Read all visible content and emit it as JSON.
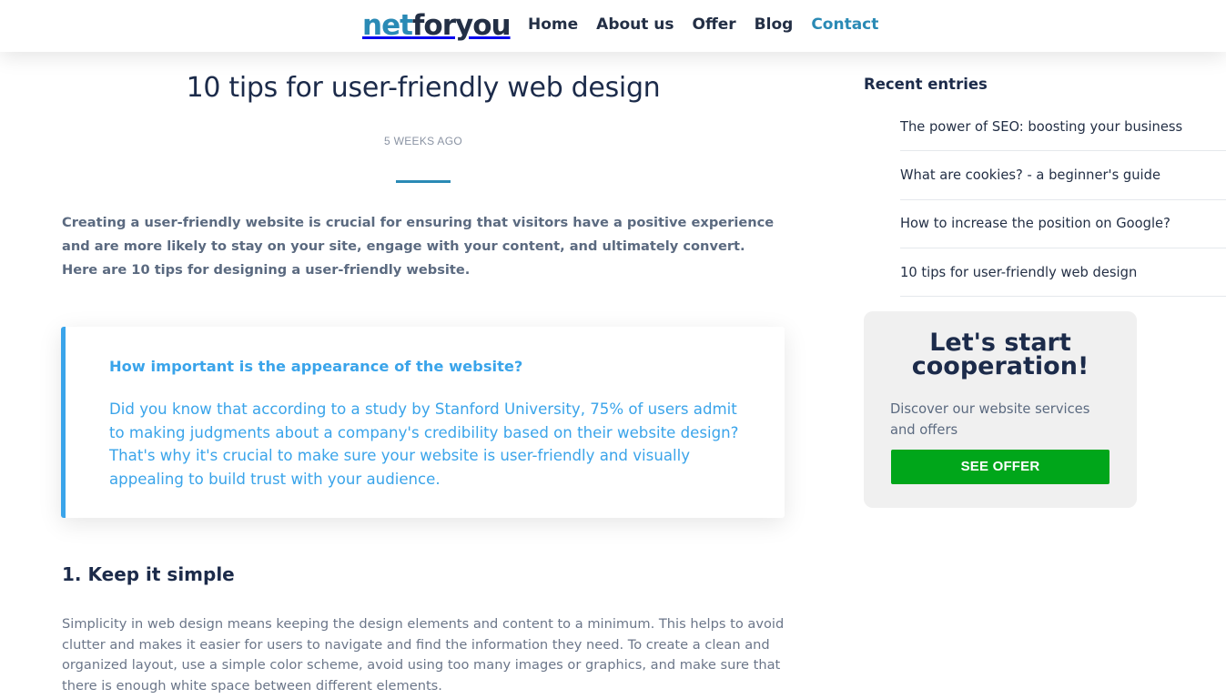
{
  "header": {
    "logo_part1": "net",
    "logo_part2": "foryou",
    "nav": [
      {
        "label": "Home"
      },
      {
        "label": "About us"
      },
      {
        "label": "Offer"
      },
      {
        "label": "Blog"
      },
      {
        "label": "Contact",
        "active": true
      }
    ]
  },
  "article": {
    "title": "10 tips for user-friendly web design",
    "date": "5 WEEKS AGO",
    "intro": "Creating a user-friendly website is crucial for ensuring that visitors have a positive experience and are more likely to stay on your site, engage with your content, and ultimately convert. Here are 10 tips for designing a user-friendly website.",
    "callout": {
      "question": "How important is the appearance of the website?",
      "body": "Did you know that according to a study by Stanford University, 75% of users admit to making judgments about a company's credibility based on their website design? That's why it's crucial to make sure your website is user-friendly and visually appealing to build trust with your audience."
    },
    "section1": {
      "heading": "1. Keep it simple",
      "text": "Simplicity in web design means keeping the design elements and content to a minimum. This helps to avoid clutter and makes it easier for users to navigate and find the information they need. To create a clean and organized layout, use a simple color scheme, avoid using too many images or graphics, and make sure that there is enough white space between different elements."
    }
  },
  "sidebar": {
    "recent_title": "Recent entries",
    "recent": [
      {
        "label": "The power of SEO: boosting your business"
      },
      {
        "label": "What are cookies? - a beginner's guide"
      },
      {
        "label": "How to increase the position on Google?"
      },
      {
        "label": "10 tips for user-friendly web design"
      }
    ],
    "cta": {
      "title": "Let's start cooperation!",
      "text": "Discover our website services and offers",
      "button": "SEE OFFER"
    }
  },
  "colors": {
    "brand_blue": "#2a8ab5",
    "callout_blue": "#3aa4ea",
    "cta_green": "#00a61a",
    "navy": "#1c2b4a"
  }
}
